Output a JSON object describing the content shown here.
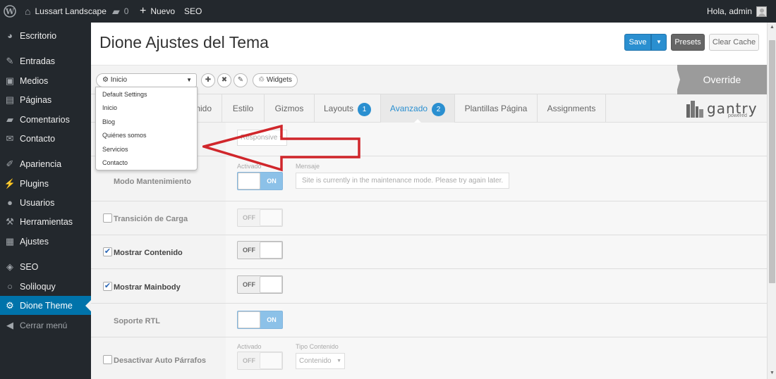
{
  "adminbar": {
    "site_name": "Lussart Landscape",
    "comments_count": "0",
    "new_label": "Nuevo",
    "seo_label": "SEO",
    "greeting": "Hola, admin"
  },
  "sidebar": {
    "items": [
      {
        "label": "Escritorio",
        "icon": "dashboard-icon"
      },
      {
        "label": "Entradas",
        "icon": "pin-icon"
      },
      {
        "label": "Medios",
        "icon": "media-icon"
      },
      {
        "label": "Páginas",
        "icon": "pages-icon"
      },
      {
        "label": "Comentarios",
        "icon": "comment-icon"
      },
      {
        "label": "Contacto",
        "icon": "mail-icon"
      },
      {
        "label": "Apariencia",
        "icon": "brush-icon"
      },
      {
        "label": "Plugins",
        "icon": "plug-icon"
      },
      {
        "label": "Usuarios",
        "icon": "user-icon"
      },
      {
        "label": "Herramientas",
        "icon": "wrench-icon"
      },
      {
        "label": "Ajustes",
        "icon": "settings-icon"
      },
      {
        "label": "SEO",
        "icon": "seo-icon"
      },
      {
        "label": "Soliloquy",
        "icon": "circle-icon"
      },
      {
        "label": "Dione Theme",
        "icon": "gear-icon"
      }
    ],
    "collapse_label": "Cerrar menú"
  },
  "header": {
    "title": "Dione Ajustes del Tema",
    "save_label": "Save",
    "presets_label": "Presets",
    "clear_cache_label": "Clear Cache"
  },
  "toolbar": {
    "preset_selected": "Inicio",
    "widgets_label": "Widgets",
    "override_label": "Override"
  },
  "dropdown": {
    "options": [
      "Default Settings",
      "Inicio",
      "Blog",
      "Quiénes somos",
      "Servicios",
      "Contacto"
    ]
  },
  "tabs": [
    {
      "label": "nido"
    },
    {
      "label": "Estilo"
    },
    {
      "label": "Gizmos"
    },
    {
      "label": "Layouts",
      "badge": "1"
    },
    {
      "label": "Avanzado",
      "badge": "2",
      "active": true
    },
    {
      "label": "Plantillas Página"
    },
    {
      "label": "Assignments"
    }
  ],
  "logo": {
    "word": "gantry",
    "sub": "powered"
  },
  "settings": {
    "responsive_value": "Responsive",
    "maintenance": {
      "label": "Modo Mantenimiento",
      "enabled_label": "Activado",
      "message_label": "Mensaje",
      "toggle": "ON",
      "message_placeholder": "Site is currently in the maintenance mode. Please try again later."
    },
    "load_transition": {
      "label": "Transición de Carga",
      "toggle": "OFF",
      "checked": false
    },
    "show_content": {
      "label": "Mostrar Contenido",
      "toggle": "OFF",
      "checked": true
    },
    "show_mainbody": {
      "label": "Mostrar Mainbody",
      "toggle": "OFF",
      "checked": true
    },
    "rtl": {
      "label": "Soporte RTL",
      "toggle": "ON"
    },
    "auto_paragraphs": {
      "label": "Desactivar Auto Párrafos",
      "enabled_label": "Activado",
      "content_type_label": "Tipo Contenido",
      "toggle": "OFF",
      "content_type_value": "Contenido",
      "checked": false
    }
  },
  "colors": {
    "adminbar_bg": "#23282d",
    "accent": "#2a8fd0",
    "active_menu": "#0073aa",
    "annotation_arrow": "#d0262b"
  }
}
